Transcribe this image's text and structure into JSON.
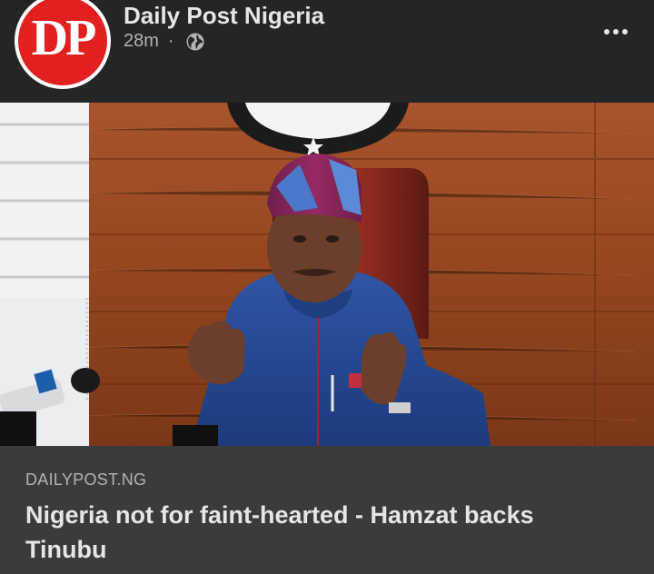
{
  "header": {
    "avatar_text": "DP",
    "page_name": "Daily Post Nigeria",
    "timestamp": "28m",
    "separator": "·",
    "privacy_icon": "globe-icon",
    "more_icon": "more-horizontal-icon"
  },
  "image": {
    "icon": "photo"
  },
  "link_preview": {
    "domain": "DAILYPOST.NG",
    "title": "Nigeria not for faint-hearted - Hamzat backs Tinubu"
  },
  "colors": {
    "background": "#242526",
    "card": "#3a3b3c",
    "primary_text": "#e4e6eb",
    "secondary_text": "#b0b3b8",
    "brand_red": "#e1201f"
  }
}
